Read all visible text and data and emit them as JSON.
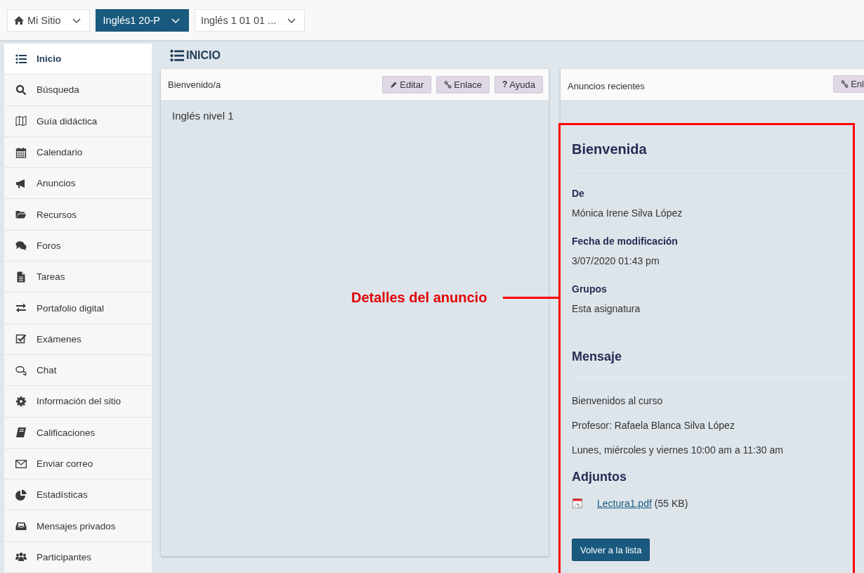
{
  "top_bar": {
    "sites": [
      {
        "label": "Mi Sitio",
        "selected": false,
        "kind": "home"
      },
      {
        "label": "Inglés1 20-P",
        "selected": true,
        "kind": "site"
      },
      {
        "label": "Inglés 1 01 01 ...",
        "selected": false,
        "kind": "site"
      }
    ]
  },
  "sidebar": {
    "items": [
      {
        "label": "Inicio",
        "selected": true
      },
      {
        "label": "Búsqueda",
        "selected": false
      },
      {
        "label": "Guía didáctica",
        "selected": false
      },
      {
        "label": "Calendario",
        "selected": false
      },
      {
        "label": "Anuncios",
        "selected": false
      },
      {
        "label": "Recursos",
        "selected": false
      },
      {
        "label": "Foros",
        "selected": false
      },
      {
        "label": "Tareas",
        "selected": false
      },
      {
        "label": "Portafolio digital",
        "selected": false
      },
      {
        "label": "Exámenes",
        "selected": false
      },
      {
        "label": "Chat",
        "selected": false
      },
      {
        "label": "Información del sitio",
        "selected": false
      },
      {
        "label": "Calificaciones",
        "selected": false
      },
      {
        "label": "Enviar correo",
        "selected": false
      },
      {
        "label": "Estadísticas",
        "selected": false
      },
      {
        "label": "Mensajes privados",
        "selected": false
      },
      {
        "label": "Participantes",
        "selected": false
      }
    ]
  },
  "page_title": "INICIO",
  "left_panel": {
    "title": "Bienvenido/a",
    "buttons": [
      {
        "kind": "edit",
        "label": "Editar"
      },
      {
        "kind": "link",
        "label": "Enlace"
      },
      {
        "kind": "help",
        "glyph": "?",
        "label": "Ayuda"
      }
    ],
    "body": "Inglés nivel 1"
  },
  "right_panel": {
    "title": "Anuncios recientes",
    "buttons": [
      {
        "kind": "link",
        "label": "Enl"
      }
    ],
    "announcement": {
      "title": "Bienvenida",
      "fields": [
        {
          "label": "De",
          "value": "Mónica Irene Silva López"
        },
        {
          "label": "Fecha de modificación",
          "value": "3/07/2020 01:43 pm"
        },
        {
          "label": "Grupos",
          "value": "Esta asignatura"
        }
      ],
      "message_heading": "Mensaje",
      "message_lines": [
        "Bienvenidos al curso",
        "Profesor: Rafaela Blanca Silva López",
        "Lunes, miércoles y viernes 10:00 am a 11:30 am"
      ],
      "attachments_heading": "Adjuntos",
      "attachments": [
        {
          "name": "Lectura1.pdf",
          "size": "(55 KB)"
        }
      ],
      "back_button": "Volver a la lista"
    }
  },
  "annotation": {
    "label": "Detalles del anuncio"
  }
}
